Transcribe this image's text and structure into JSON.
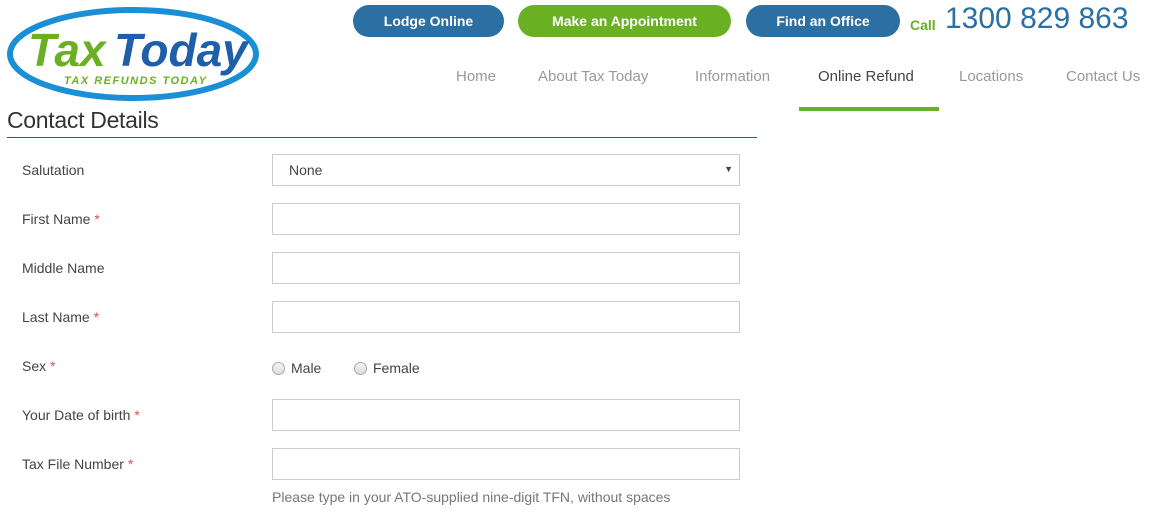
{
  "brand": {
    "name_part1": "Tax",
    "name_part2": "Today",
    "tagline": "TAX REFUNDS TODAY",
    "colors": {
      "green": "#6ab023",
      "blue": "#1f5ea8",
      "ring": "#1a8fd6"
    }
  },
  "header": {
    "buttons": [
      {
        "label": "Lodge Online"
      },
      {
        "label": "Make an Appointment"
      },
      {
        "label": "Find an Office"
      }
    ],
    "call_label": "Call",
    "phone": "1300 829 863"
  },
  "nav": {
    "items": [
      {
        "label": "Home"
      },
      {
        "label": "About Tax Today"
      },
      {
        "label": "Information"
      },
      {
        "label": "Online Refund"
      },
      {
        "label": "Locations"
      },
      {
        "label": "Contact Us"
      }
    ],
    "active": "Online Refund"
  },
  "form": {
    "section_title": "Contact Details",
    "required_marker": "*",
    "fields": {
      "salutation": {
        "label": "Salutation",
        "value": "None"
      },
      "first_name": {
        "label": "First Name",
        "value": ""
      },
      "middle_name": {
        "label": "Middle Name",
        "value": ""
      },
      "last_name": {
        "label": "Last Name",
        "value": ""
      },
      "sex": {
        "label": "Sex",
        "options": [
          "Male",
          "Female"
        ]
      },
      "dob": {
        "label": "Your Date of birth",
        "value": ""
      },
      "tfn": {
        "label": "Tax File Number",
        "value": "",
        "help": "Please type in your ATO-supplied nine-digit TFN, without spaces"
      }
    }
  }
}
